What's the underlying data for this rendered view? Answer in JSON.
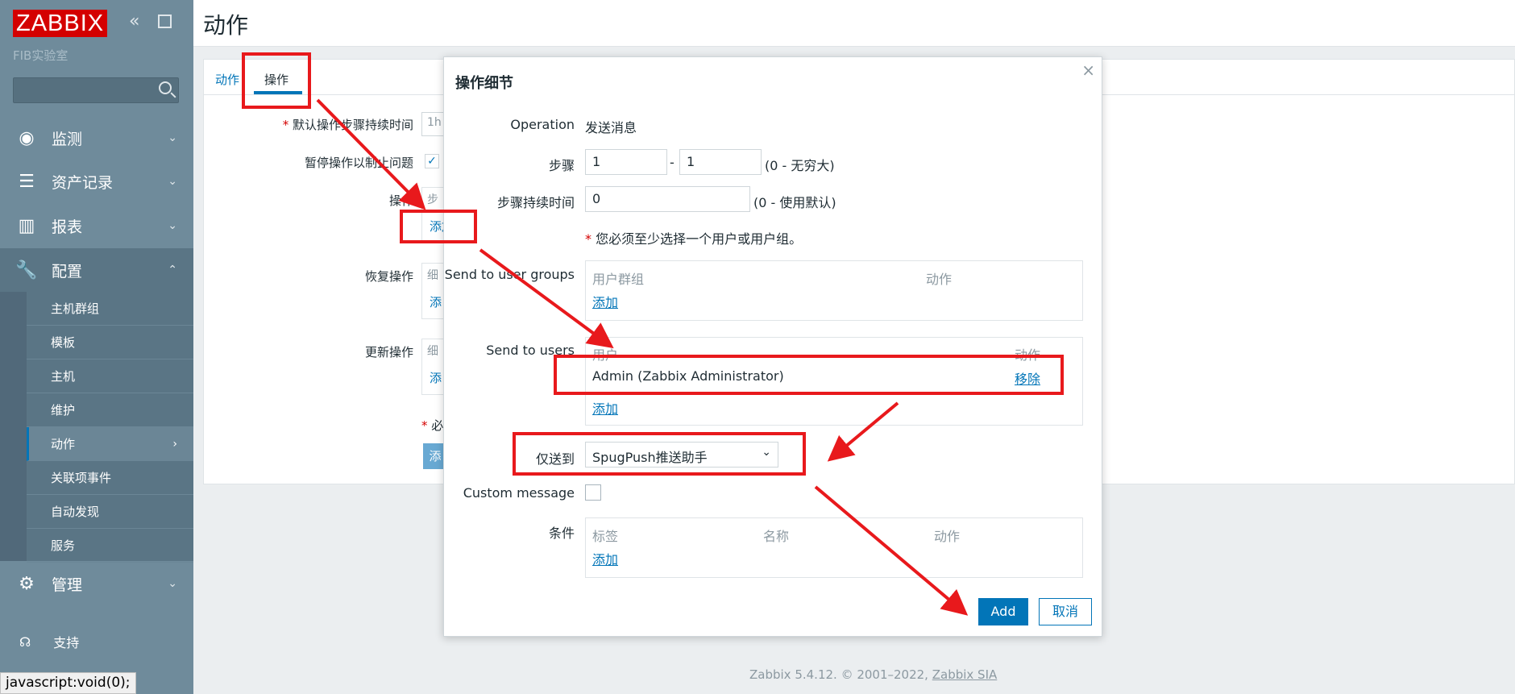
{
  "sidebar": {
    "logo": "ZABBIX",
    "server_name": "FIB实验室",
    "collapse_icon": "collapse-icon",
    "menu": [
      {
        "label": "监测",
        "icon": "eye-icon"
      },
      {
        "label": "资产记录",
        "icon": "list-icon"
      },
      {
        "label": "报表",
        "icon": "bar-chart-icon"
      },
      {
        "label": "配置",
        "icon": "wrench-icon"
      },
      {
        "label": "管理",
        "icon": "cog-icon"
      }
    ],
    "submenu": [
      "主机群组",
      "模板",
      "主机",
      "维护",
      "动作",
      "关联项事件",
      "自动发现",
      "服务"
    ],
    "support": "支持"
  },
  "status_bar": "javascript:void(0);",
  "header": {
    "title": "动作"
  },
  "tabs": [
    {
      "label": "动作"
    },
    {
      "label": "操作"
    }
  ],
  "background_form": {
    "default_duration_label": "默认操作步骤持续时间",
    "default_duration_value": "1h",
    "pause_label": "暂停操作以制止问题",
    "operations_label": "操作",
    "operations_col_partial": "步",
    "add_link": "添加",
    "recovery_label": "恢复操作",
    "recovery_col_partial": "细",
    "recovery_add_partial": "添",
    "update_label": "更新操作",
    "update_col_partial": "细",
    "update_add_partial": "添",
    "required_partial": "必",
    "button_partial": "添"
  },
  "footer": {
    "text": "Zabbix 5.4.12. © 2001–2022, ",
    "link": "Zabbix SIA"
  },
  "modal": {
    "title": "操作细节",
    "operation_label": "Operation",
    "operation_value": "发送消息",
    "steps_label": "步骤",
    "steps_from": "1",
    "steps_sep": "-",
    "steps_to": "1",
    "steps_hint": "(0 - 无穷大)",
    "step_duration_label": "步骤持续时间",
    "step_duration_value": "0",
    "step_duration_hint": "(0 - 使用默认)",
    "must_select_note": "您必须至少选择一个用户或用户组。",
    "user_groups": {
      "label": "Send to user groups",
      "col_group": "用户群组",
      "col_action": "动作",
      "add": "添加"
    },
    "users": {
      "label": "Send to users",
      "col_user": "用户",
      "col_action": "动作",
      "rows": [
        {
          "name": "Admin (Zabbix Administrator)",
          "remove": "移除"
        }
      ],
      "add": "添加"
    },
    "send_only_to_label": "仅送到",
    "send_only_to_value": "SpugPush推送助手",
    "custom_message_label": "Custom message",
    "conditions": {
      "label": "条件",
      "col_tag": "标签",
      "col_name": "名称",
      "col_action": "动作",
      "add": "添加"
    },
    "add_button": "Add",
    "cancel_button": "取消"
  },
  "colors": {
    "accent": "#0275b8",
    "sidebar": "#6f8b9b",
    "annotation": "#e8191c",
    "logo": "#d40000"
  }
}
